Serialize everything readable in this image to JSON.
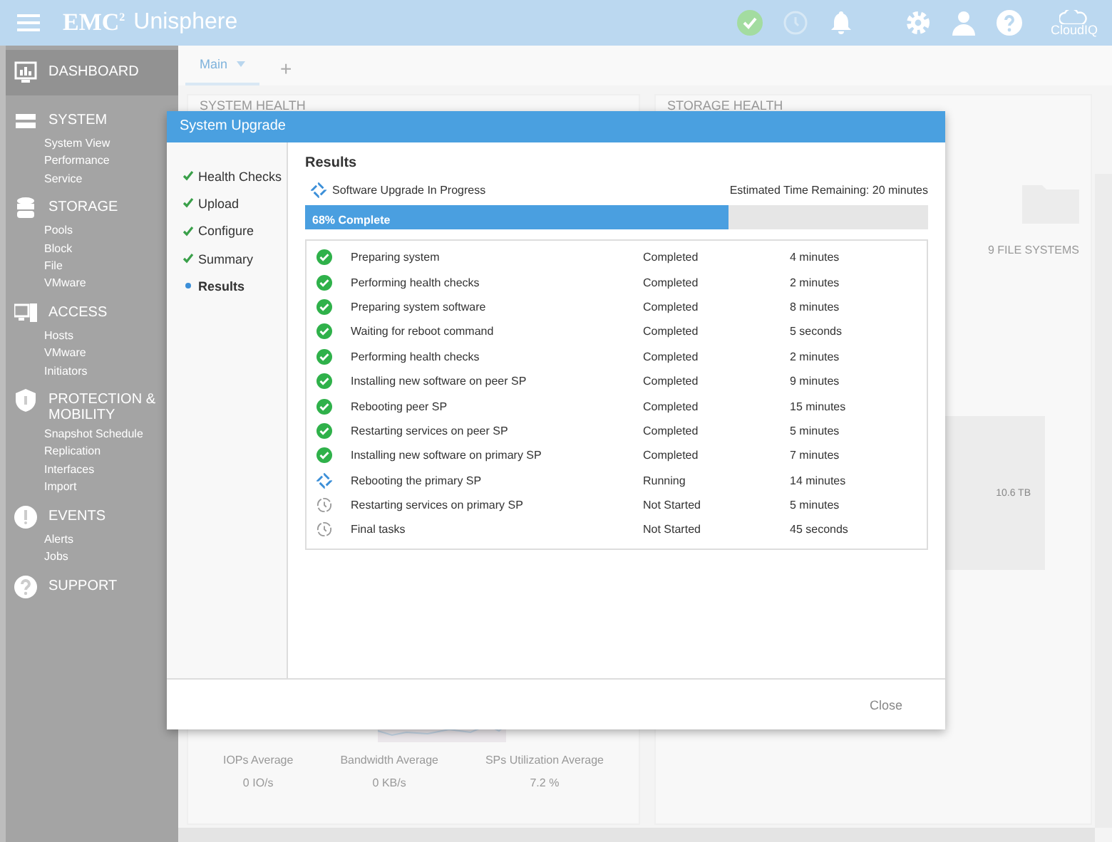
{
  "app_bar": {
    "brand": "EMC",
    "brand_sup": "2",
    "product": "Unisphere",
    "cloud_label": "CloudIQ"
  },
  "sidebar": [
    {
      "label": "DASHBOARD",
      "selected": true
    },
    {
      "label": "SYSTEM",
      "selected": false,
      "items": [
        "System View",
        "Performance",
        "Service"
      ]
    },
    {
      "label": "STORAGE",
      "selected": false,
      "items": [
        "Pools",
        "Block",
        "File",
        "VMware"
      ]
    },
    {
      "label": "ACCESS",
      "selected": false,
      "items": [
        "Hosts",
        "VMware",
        "Initiators"
      ]
    },
    {
      "label": "PROTECTION & MOBILITY",
      "selected": false,
      "items": [
        "Snapshot Schedule",
        "Replication",
        "Interfaces",
        "Import"
      ]
    },
    {
      "label": "EVENTS",
      "selected": false,
      "items": [
        "Alerts",
        "Jobs"
      ]
    },
    {
      "label": "SUPPORT",
      "selected": false
    }
  ],
  "tabs": [
    {
      "label": "Main",
      "selected": true
    },
    {
      "label": "+",
      "selected": false
    }
  ],
  "dashboard": {
    "system_health_title": "SYSTEM HEALTH",
    "storage_health_title": "STORAGE HEALTH",
    "file_systems_label": "9 FILE SYSTEMS",
    "capacity_label": "10.6 TB",
    "metrics": [
      {
        "label": "IOPs Average",
        "value": "0 IO/s"
      },
      {
        "label": "Bandwidth Average",
        "value": "0 KB/s"
      },
      {
        "label": "SPs Utilization Average",
        "value": "7.2 %"
      }
    ]
  },
  "dialog": {
    "title": "System Upgrade",
    "steps": [
      {
        "label": "Health Checks",
        "completed": true,
        "selected": false
      },
      {
        "label": "Upload",
        "completed": true,
        "selected": false
      },
      {
        "label": "Configure",
        "completed": true,
        "selected": false
      },
      {
        "label": "Summary",
        "completed": true,
        "selected": false
      },
      {
        "label": "Results",
        "completed": false,
        "selected": true
      }
    ],
    "heading": "Results",
    "status_text": "Software Upgrade In Progress",
    "eta": "Estimated Time Remaining: 20 minutes",
    "progress": {
      "label": "68% Complete",
      "level": 0.68
    },
    "tasks": [
      {
        "name": "Preparing system",
        "status": "Completed",
        "duration": "4 minutes",
        "kind": "completed"
      },
      {
        "name": "Performing health checks",
        "status": "Completed",
        "duration": "2 minutes",
        "kind": "completed"
      },
      {
        "name": "Preparing system software",
        "status": "Completed",
        "duration": "8 minutes",
        "kind": "completed"
      },
      {
        "name": "Waiting for reboot command",
        "status": "Completed",
        "duration": "5 seconds",
        "kind": "completed"
      },
      {
        "name": "Performing health checks",
        "status": "Completed",
        "duration": "2 minutes",
        "kind": "completed"
      },
      {
        "name": "Installing new software on peer SP",
        "status": "Completed",
        "duration": "9 minutes",
        "kind": "completed"
      },
      {
        "name": "Rebooting peer SP",
        "status": "Completed",
        "duration": "15 minutes",
        "kind": "completed"
      },
      {
        "name": "Restarting services on peer SP",
        "status": "Completed",
        "duration": "5 minutes",
        "kind": "completed"
      },
      {
        "name": "Installing new software on primary SP",
        "status": "Completed",
        "duration": "7 minutes",
        "kind": "completed"
      },
      {
        "name": "Rebooting the primary SP",
        "status": "Running",
        "duration": "14 minutes",
        "kind": "running"
      },
      {
        "name": "Restarting services on primary SP",
        "status": "Not Started",
        "duration": "5 minutes",
        "kind": "not_started"
      },
      {
        "name": "Final tasks",
        "status": "Not Started",
        "duration": "45 seconds",
        "kind": "not_started"
      }
    ],
    "close_button": "Close"
  }
}
